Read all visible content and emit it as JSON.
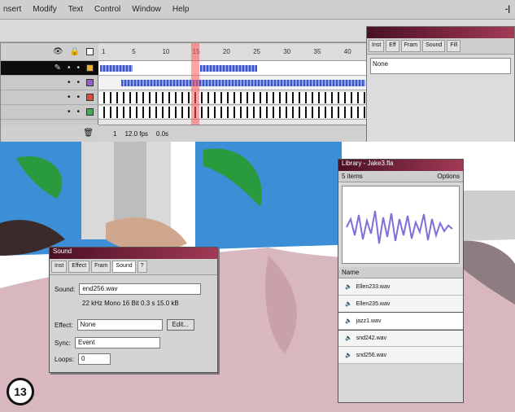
{
  "menubar": {
    "items": [
      "nsert",
      "Modify",
      "Text",
      "Control",
      "Window",
      "Help"
    ],
    "right": "-|"
  },
  "timeline": {
    "ruler": [
      "1",
      "5",
      "10",
      "15",
      "20",
      "25",
      "30",
      "35",
      "40"
    ],
    "status": [
      "1",
      "12.0 fps",
      "0.0s"
    ]
  },
  "panel": {
    "title": "",
    "tabs": [
      "Inst",
      "Eff",
      "Fram",
      "Sound",
      "Fill",
      ""
    ],
    "field": "None"
  },
  "sound_dialog": {
    "title": "Sound",
    "tabs": [
      "Inst",
      "Effect",
      "Fram",
      "Sound",
      "?"
    ],
    "sound_label": "Sound:",
    "sound_value": "end256.wav",
    "info": "22 kHz Mono 16 Bit 0.3 s 15.0 kB",
    "effect_label": "Effect:",
    "effect_value": "None",
    "edit_label": "Edit...",
    "sync_label": "Sync:",
    "sync_value": "Event",
    "loops_label": "Loops:",
    "loops_value": "0"
  },
  "library": {
    "title": "Library - Jake3.fla",
    "items_count": "5 items",
    "options": "Options",
    "name_header": "Name",
    "items": [
      "Ellen233.wav",
      "Ellen235.wav",
      "jazz1.wav",
      "snd242.wav",
      "snd256.wav"
    ],
    "selected_index": 2
  },
  "badge": {
    "label": "13"
  },
  "colors": {
    "sky": "#3c8fd6",
    "leaf": "#2a9a3e",
    "skin": "#d9b7bf",
    "hair": "#3a2a2a",
    "titlebar": "#7a1f3a"
  }
}
